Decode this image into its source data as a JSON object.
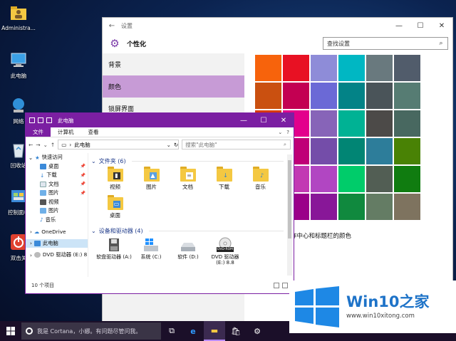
{
  "desktop": {
    "icons": [
      {
        "label": "Administra..."
      },
      {
        "label": "此电脑"
      },
      {
        "label": "网络"
      },
      {
        "label": "回收站"
      },
      {
        "label": "控制面板"
      },
      {
        "label": "双击关"
      }
    ]
  },
  "settings": {
    "title": "设置",
    "heading": "个性化",
    "search_placeholder": "查找设置",
    "nav": [
      {
        "label": "背景"
      },
      {
        "label": "颜色"
      },
      {
        "label": "锁屏界面"
      }
    ],
    "active_nav": "颜色",
    "swatch_colors": [
      "#f7630c",
      "#e81123",
      "#8e8cd8",
      "#00b7c3",
      "#69797e",
      "#515c6b",
      "#ca5010",
      "#c30052",
      "#6b69d6",
      "#038387",
      "#4a5459",
      "#567c73",
      "#da3b01",
      "#e3008c",
      "#8764b8",
      "#00b294",
      "#4c4a48",
      "#486860",
      "#d13438",
      "#bf0077",
      "#744da9",
      "#018574",
      "#2d7d9a",
      "#498205",
      "#e74856",
      "#c239b3",
      "#b146c2",
      "#00cc6a",
      "#525e54",
      "#107c10",
      "#ff4343",
      "#9a0089",
      "#881798",
      "#10893e",
      "#647c64",
      "#7e735f"
    ],
    "caption": "、任务栏、操作中心和标题栏的颜色"
  },
  "explorer": {
    "title": "此电脑",
    "ribbon_tabs": [
      "文件",
      "计算机",
      "查看"
    ],
    "address": "此电脑",
    "search_placeholder": "搜索\"此电脑\"",
    "nav": [
      {
        "label": "快速访问",
        "icon": "star"
      },
      {
        "label": "桌面",
        "icon": "desktop"
      },
      {
        "label": "下载",
        "icon": "download"
      },
      {
        "label": "文档",
        "icon": "documents"
      },
      {
        "label": "图片",
        "icon": "pictures"
      },
      {
        "label": "视频",
        "icon": "videos"
      },
      {
        "label": "图片",
        "icon": "pictures"
      },
      {
        "label": "音乐",
        "icon": "music"
      },
      {
        "label": "OneDrive",
        "icon": "cloud"
      },
      {
        "label": "此电脑",
        "icon": "computer"
      },
      {
        "label": "DVD 驱动器 (E:) 8",
        "icon": "dvd"
      }
    ],
    "folders_heading": "文件夹 (6)",
    "folders": [
      {
        "label": "视频",
        "icon": "film"
      },
      {
        "label": "图片",
        "icon": "picture"
      },
      {
        "label": "文档",
        "icon": "document"
      },
      {
        "label": "下载",
        "icon": "arrow-down"
      },
      {
        "label": "音乐",
        "icon": "note"
      },
      {
        "label": "桌面",
        "icon": "monitor"
      }
    ],
    "drives_heading": "设备和驱动器 (4)",
    "drives": [
      {
        "label": "软盘驱动器 (A:)",
        "icon": "floppy"
      },
      {
        "label": "系统 (C:)",
        "icon": "windows-drive"
      },
      {
        "label": "软件 (D:)",
        "icon": "hdd"
      },
      {
        "label": "DVD 驱动器 (E:) 8.8",
        "icon": "dvd-rom",
        "badge": "DVD-ROM"
      }
    ],
    "status": "10 个项目"
  },
  "taskbar": {
    "cortana_placeholder": "我是 Cortana，小娜。有问题尽管问我。"
  },
  "watermark": {
    "brand_latin": "Win10",
    "brand_cjk": "之家",
    "url": "www.win10xitong.com"
  }
}
